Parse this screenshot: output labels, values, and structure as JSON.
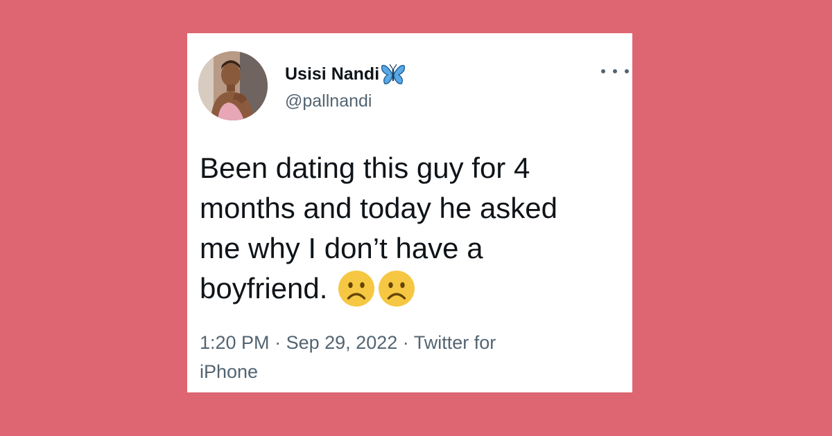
{
  "tweet": {
    "author": {
      "display_name": "Usisi Nandi",
      "name_emoji": "butterfly-icon",
      "handle": "@pallnandi"
    },
    "text_lines": [
      "Been dating this guy for 4",
      "months and today he asked",
      "me why I don’t have a",
      "boyfriend."
    ],
    "text_emojis": [
      "frowning-face-icon",
      "frowning-face-icon"
    ],
    "timestamp_time": "1:20 PM",
    "timestamp_date": "Sep 29, 2022",
    "source_part1": "Twitter for",
    "source_part2": "iPhone",
    "separator": "·"
  },
  "colors": {
    "background": "#dd6672",
    "card": "#ffffff",
    "text_primary": "#0f1419",
    "text_secondary": "#536471",
    "emoji_yellow": "#f6c742",
    "butterfly_blue": "#5aa9e6"
  }
}
